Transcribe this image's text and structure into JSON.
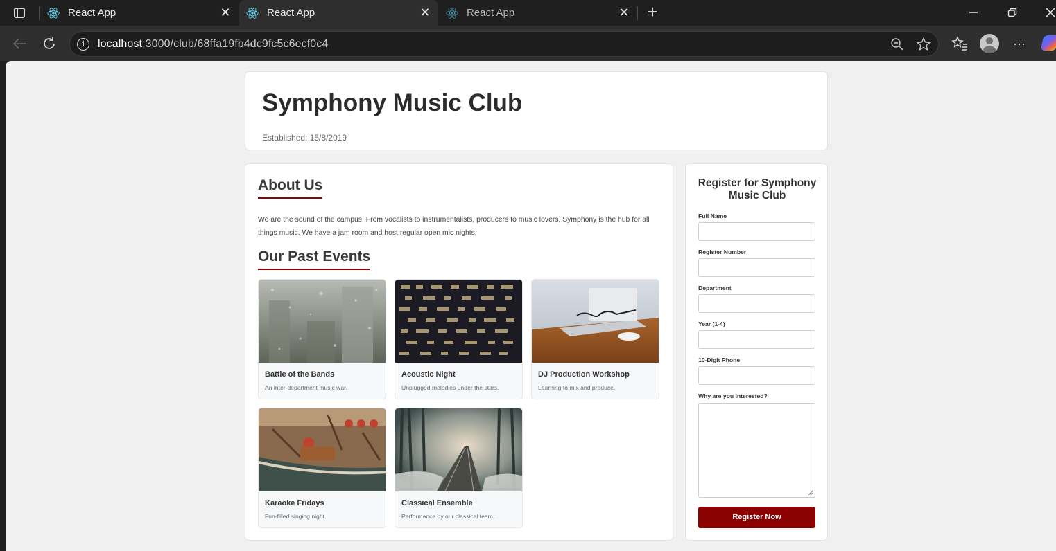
{
  "browser": {
    "tabs": [
      {
        "title": "React App",
        "state": "inactive"
      },
      {
        "title": "React App",
        "state": "active"
      },
      {
        "title": "React App",
        "state": "inactive"
      }
    ],
    "url_host": "localhost",
    "url_path": ":3000/club/68ffa19fb4dc9fc5c6ecf0c4",
    "colors": {
      "chrome_dark": "#1f1f1f",
      "chrome_toolbar": "#2e2e2e",
      "react_blue": "#61dafb"
    }
  },
  "club": {
    "name": "Symphony Music Club",
    "established": "Established: 15/8/2019"
  },
  "about": {
    "heading": "About Us",
    "text": "We are the sound of the campus. From vocalists to instrumentalists, producers to music lovers, Symphony is the hub for all things music. We have a jam room and host regular open mic nights."
  },
  "events": {
    "heading": "Our Past Events",
    "items": [
      {
        "name": "Battle of the Bands",
        "description": "An inter-department music war.",
        "image": "rainy-window-city-photo"
      },
      {
        "name": "Acoustic Night",
        "description": "Unplugged melodies under the stars.",
        "image": "building-lights-night-photo"
      },
      {
        "name": "DJ Production Workshop",
        "description": "Learning to mix and produce.",
        "image": "glasses-laptop-desk-photo"
      },
      {
        "name": "Karaoke Fridays",
        "description": "Fun-filled singing night.",
        "image": "old-boat-harbor-photo"
      },
      {
        "name": "Classical Ensemble",
        "description": "Performance by our classical team.",
        "image": "misty-forest-railway-photo"
      }
    ]
  },
  "register": {
    "title": "Register for Symphony Music Club",
    "fields": [
      {
        "label": "Full Name",
        "value": ""
      },
      {
        "label": "Register Number",
        "value": ""
      },
      {
        "label": "Department",
        "value": ""
      },
      {
        "label": "Year (1-4)",
        "value": ""
      },
      {
        "label": "10-Digit Phone",
        "value": ""
      },
      {
        "label": "Why are you interested?",
        "value": ""
      }
    ],
    "submit_label": "Register Now",
    "accent_color": "#8b0000"
  }
}
